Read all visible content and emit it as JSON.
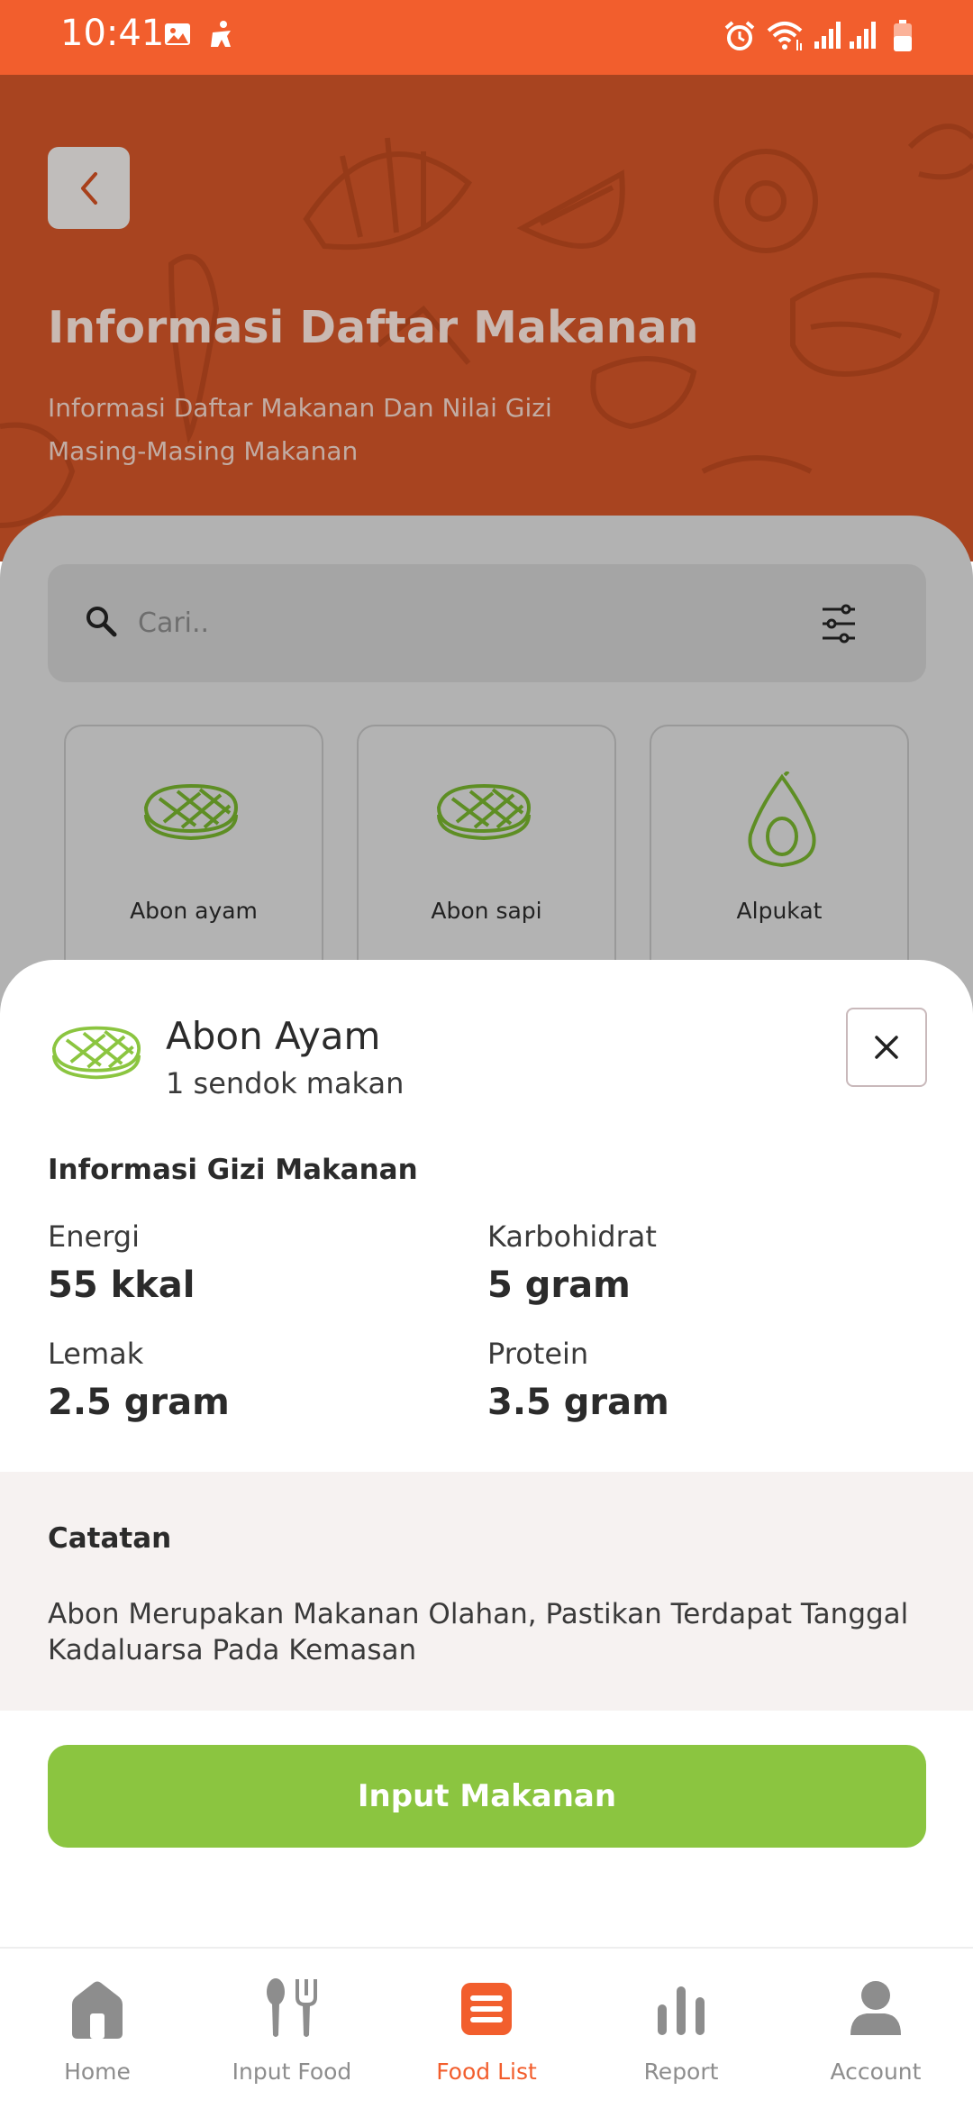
{
  "status_bar": {
    "time": "10:41"
  },
  "header": {
    "title": "Informasi Daftar Makanan",
    "subtitle": "Informasi Daftar Makanan Dan Nilai Gizi Masing-Masing Makanan"
  },
  "search": {
    "placeholder": "Cari.."
  },
  "food_cards": [
    {
      "label": "Abon ayam",
      "icon": "steak-icon"
    },
    {
      "label": "Abon sapi",
      "icon": "steak-icon"
    },
    {
      "label": "Alpukat",
      "icon": "avocado-icon"
    }
  ],
  "detail": {
    "name": "Abon Ayam",
    "portion": "1 sendok makan",
    "nutrition_heading": "Informasi Gizi Makanan",
    "nutrients": [
      {
        "label": "Energi",
        "value": "55 kkal"
      },
      {
        "label": "Karbohidrat",
        "value": "5 gram"
      },
      {
        "label": "Lemak",
        "value": "2.5 gram"
      },
      {
        "label": "Protein",
        "value": "3.5 gram"
      }
    ],
    "notes_heading": "Catatan",
    "notes_text": "Abon Merupakan Makanan Olahan, Pastikan Terdapat Tanggal Kadaluarsa Pada Kemasan",
    "action_label": "Input Makanan"
  },
  "nav": [
    {
      "label": "Home",
      "icon": "home-icon",
      "active": false
    },
    {
      "label": "Input Food",
      "icon": "cutlery-icon",
      "active": false
    },
    {
      "label": "Food List",
      "icon": "list-icon",
      "active": true
    },
    {
      "label": "Report",
      "icon": "bar-chart-icon",
      "active": false
    },
    {
      "label": "Account",
      "icon": "person-icon",
      "active": false
    }
  ],
  "colors": {
    "brand_orange": "#f25e2d",
    "header_overlay": "#a84420",
    "action_green": "#8bc540",
    "icon_green": "#8bc540"
  }
}
